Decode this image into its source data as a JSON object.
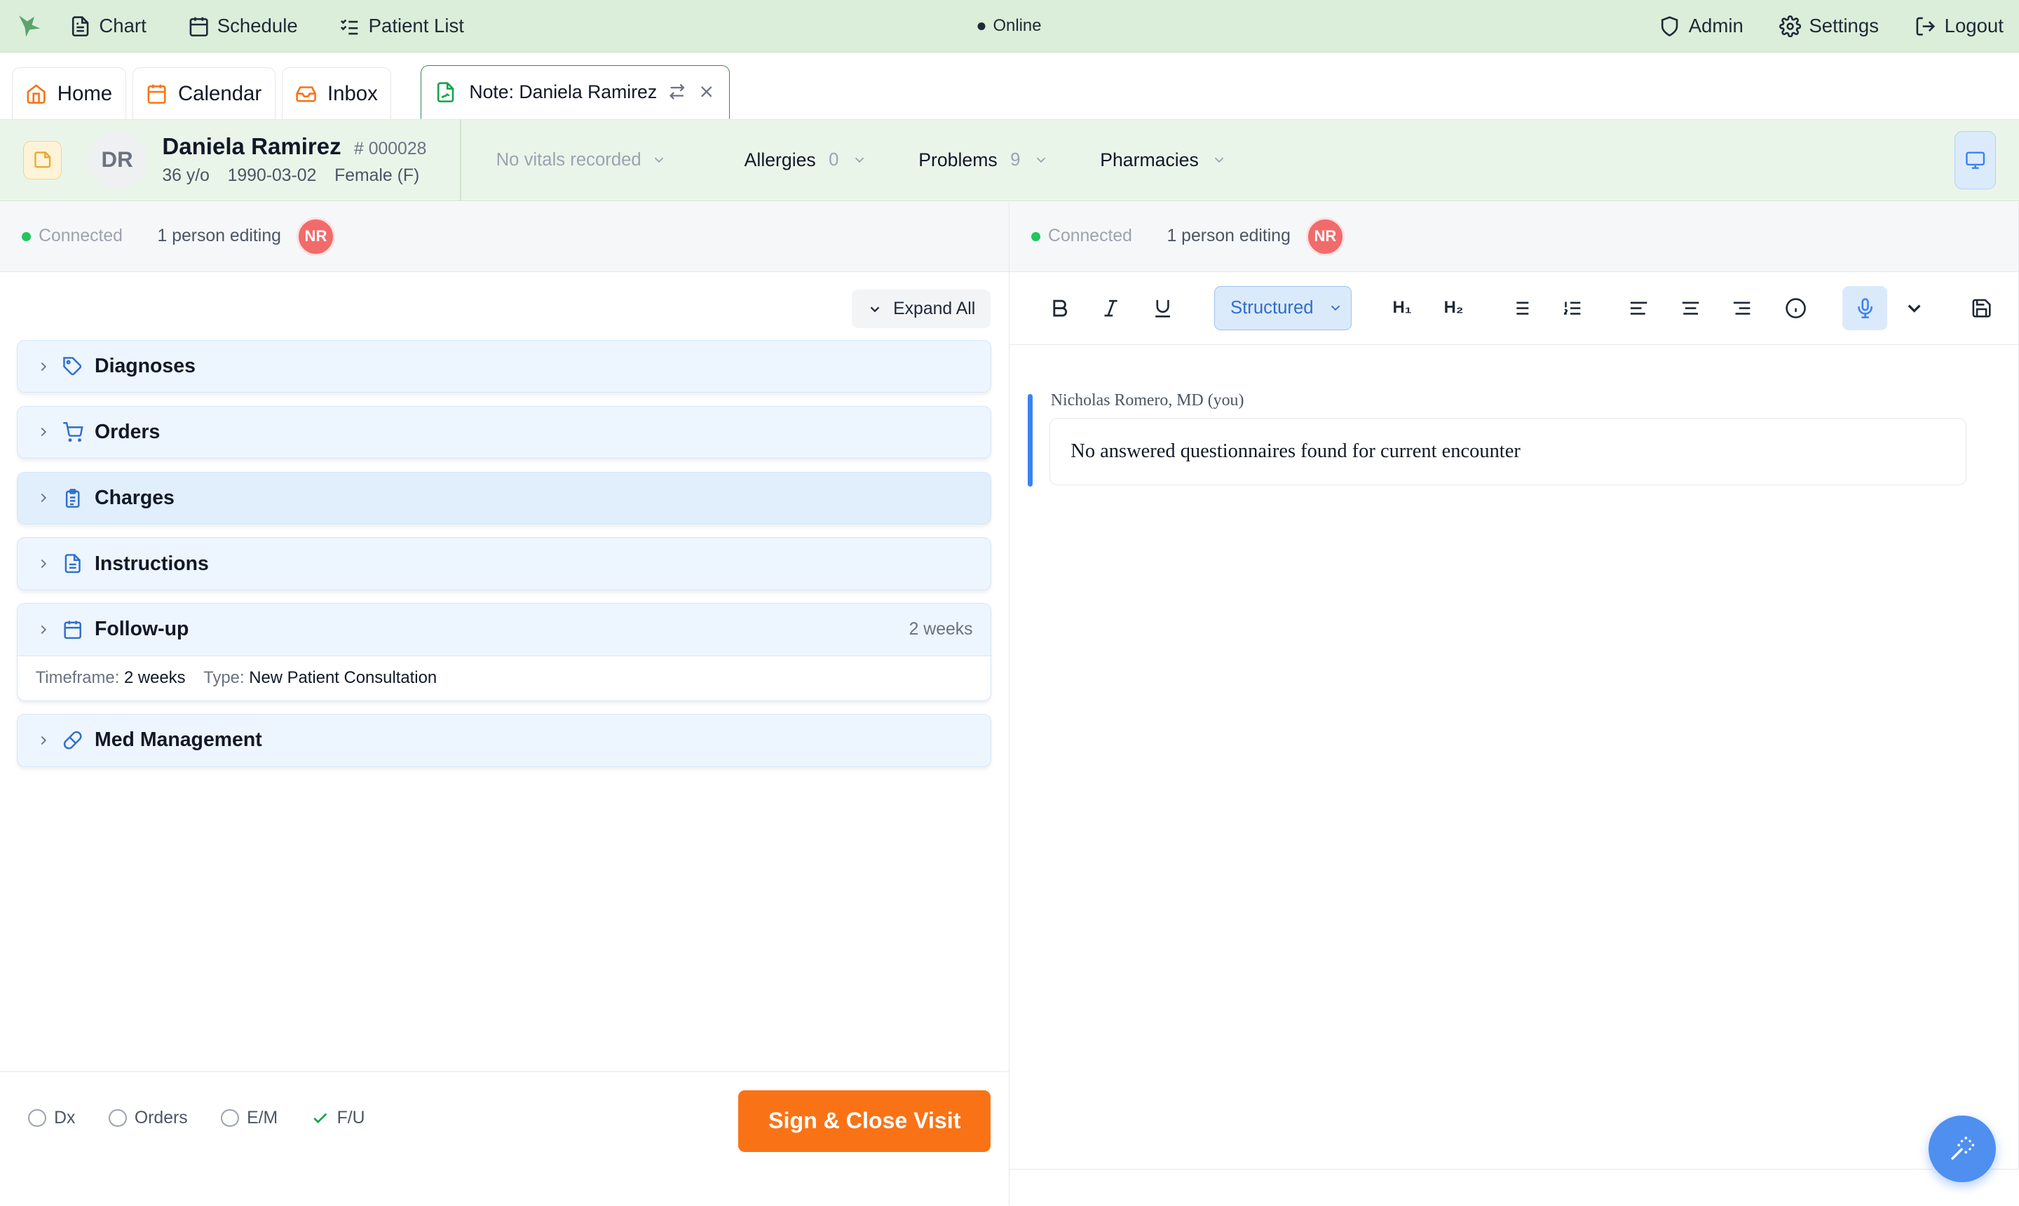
{
  "topbar": {
    "nav": [
      {
        "label": "Chart",
        "icon": "file-text-icon"
      },
      {
        "label": "Schedule",
        "icon": "calendar-icon"
      },
      {
        "label": "Patient List",
        "icon": "list-checks-icon"
      }
    ],
    "status": "Online",
    "right": [
      {
        "label": "Admin",
        "icon": "shield-icon"
      },
      {
        "label": "Settings",
        "icon": "gear-icon"
      },
      {
        "label": "Logout",
        "icon": "logout-icon"
      }
    ]
  },
  "tabs": {
    "home": "Home",
    "calendar": "Calendar",
    "inbox": "Inbox",
    "active_note": "Note: Daniela Ramirez"
  },
  "patient": {
    "initials": "DR",
    "name": "Daniela Ramirez",
    "id": "# 000028",
    "age": "36 y/o",
    "dob": "1990-03-02",
    "sex": "Female (F)",
    "vitals": "No vitals recorded",
    "allergies_label": "Allergies",
    "allergies_count": "0",
    "problems_label": "Problems",
    "problems_count": "9",
    "pharmacies_label": "Pharmacies"
  },
  "collab_left": {
    "status": "Connected",
    "editing": "1 person editing",
    "avatar": "NR"
  },
  "collab_right": {
    "status": "Connected",
    "editing": "1 person editing",
    "avatar": "NR"
  },
  "left_panel": {
    "expand_all": "Expand All",
    "sections": {
      "diagnoses": "Diagnoses",
      "orders": "Orders",
      "charges": "Charges",
      "instructions": "Instructions",
      "followup": "Follow-up",
      "followup_extra": "2 weeks",
      "followup_timeframe_label": "Timeframe:",
      "followup_timeframe_value": "2 weeks",
      "followup_type_label": "Type:",
      "followup_type_value": "New Patient Consultation",
      "med_management": "Med Management"
    }
  },
  "footer": {
    "checks": {
      "dx": "Dx",
      "orders": "Orders",
      "em": "E/M",
      "fu": "F/U"
    },
    "sign_button": "Sign & Close Visit"
  },
  "editor": {
    "format_select": "Structured",
    "h1": "H₁",
    "h2": "H₂",
    "author": "Nicholas Romero, MD (you)",
    "note_text": "No answered questionnaires found for current encounter"
  },
  "colors": {
    "topbar_bg": "#dbeed9",
    "accent_blue": "#3b82f6",
    "sign_orange": "#f97316",
    "connected_green": "#22c55e",
    "avatar_red": "#f26b6b"
  }
}
